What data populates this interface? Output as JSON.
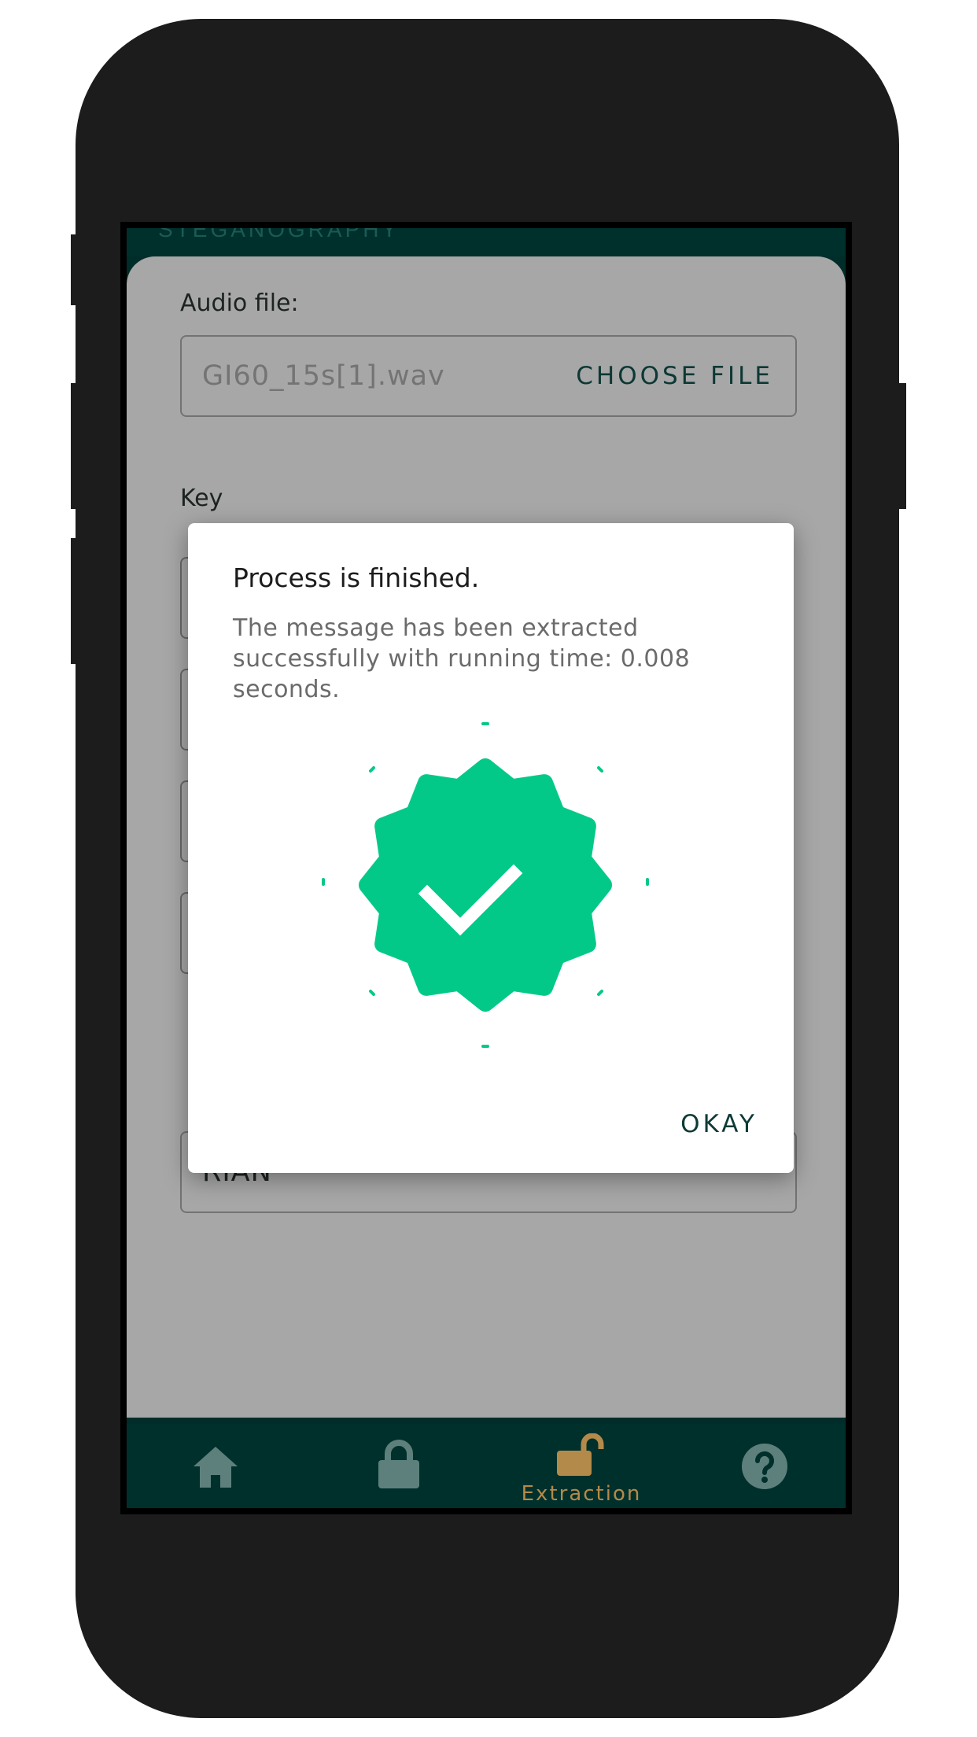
{
  "app": {
    "header_peek": "STEGANOGRAPHY"
  },
  "form": {
    "audio_label": "Audio file:",
    "audio_value": "GI60_15s[1].wav",
    "choose_file": "CHOOSE FILE",
    "key_label": "Key",
    "message_value": "RIAN"
  },
  "dialog": {
    "title": "Process is finished.",
    "message": "The message has been extracted successfully with running time: 0.008 seconds.",
    "okay": "OKAY",
    "icon": "success-badge-check-icon"
  },
  "nav": {
    "items": [
      {
        "icon": "home-icon",
        "label": "",
        "active": false
      },
      {
        "icon": "lock-icon",
        "label": "",
        "active": false
      },
      {
        "icon": "unlock-icon",
        "label": "Extraction",
        "active": true
      },
      {
        "icon": "help-icon",
        "label": "",
        "active": false
      }
    ]
  },
  "colors": {
    "accent": "#03c988",
    "nav_bg": "#00302c",
    "active": "#b38a4a",
    "inactive_icon": "#5e807c"
  }
}
